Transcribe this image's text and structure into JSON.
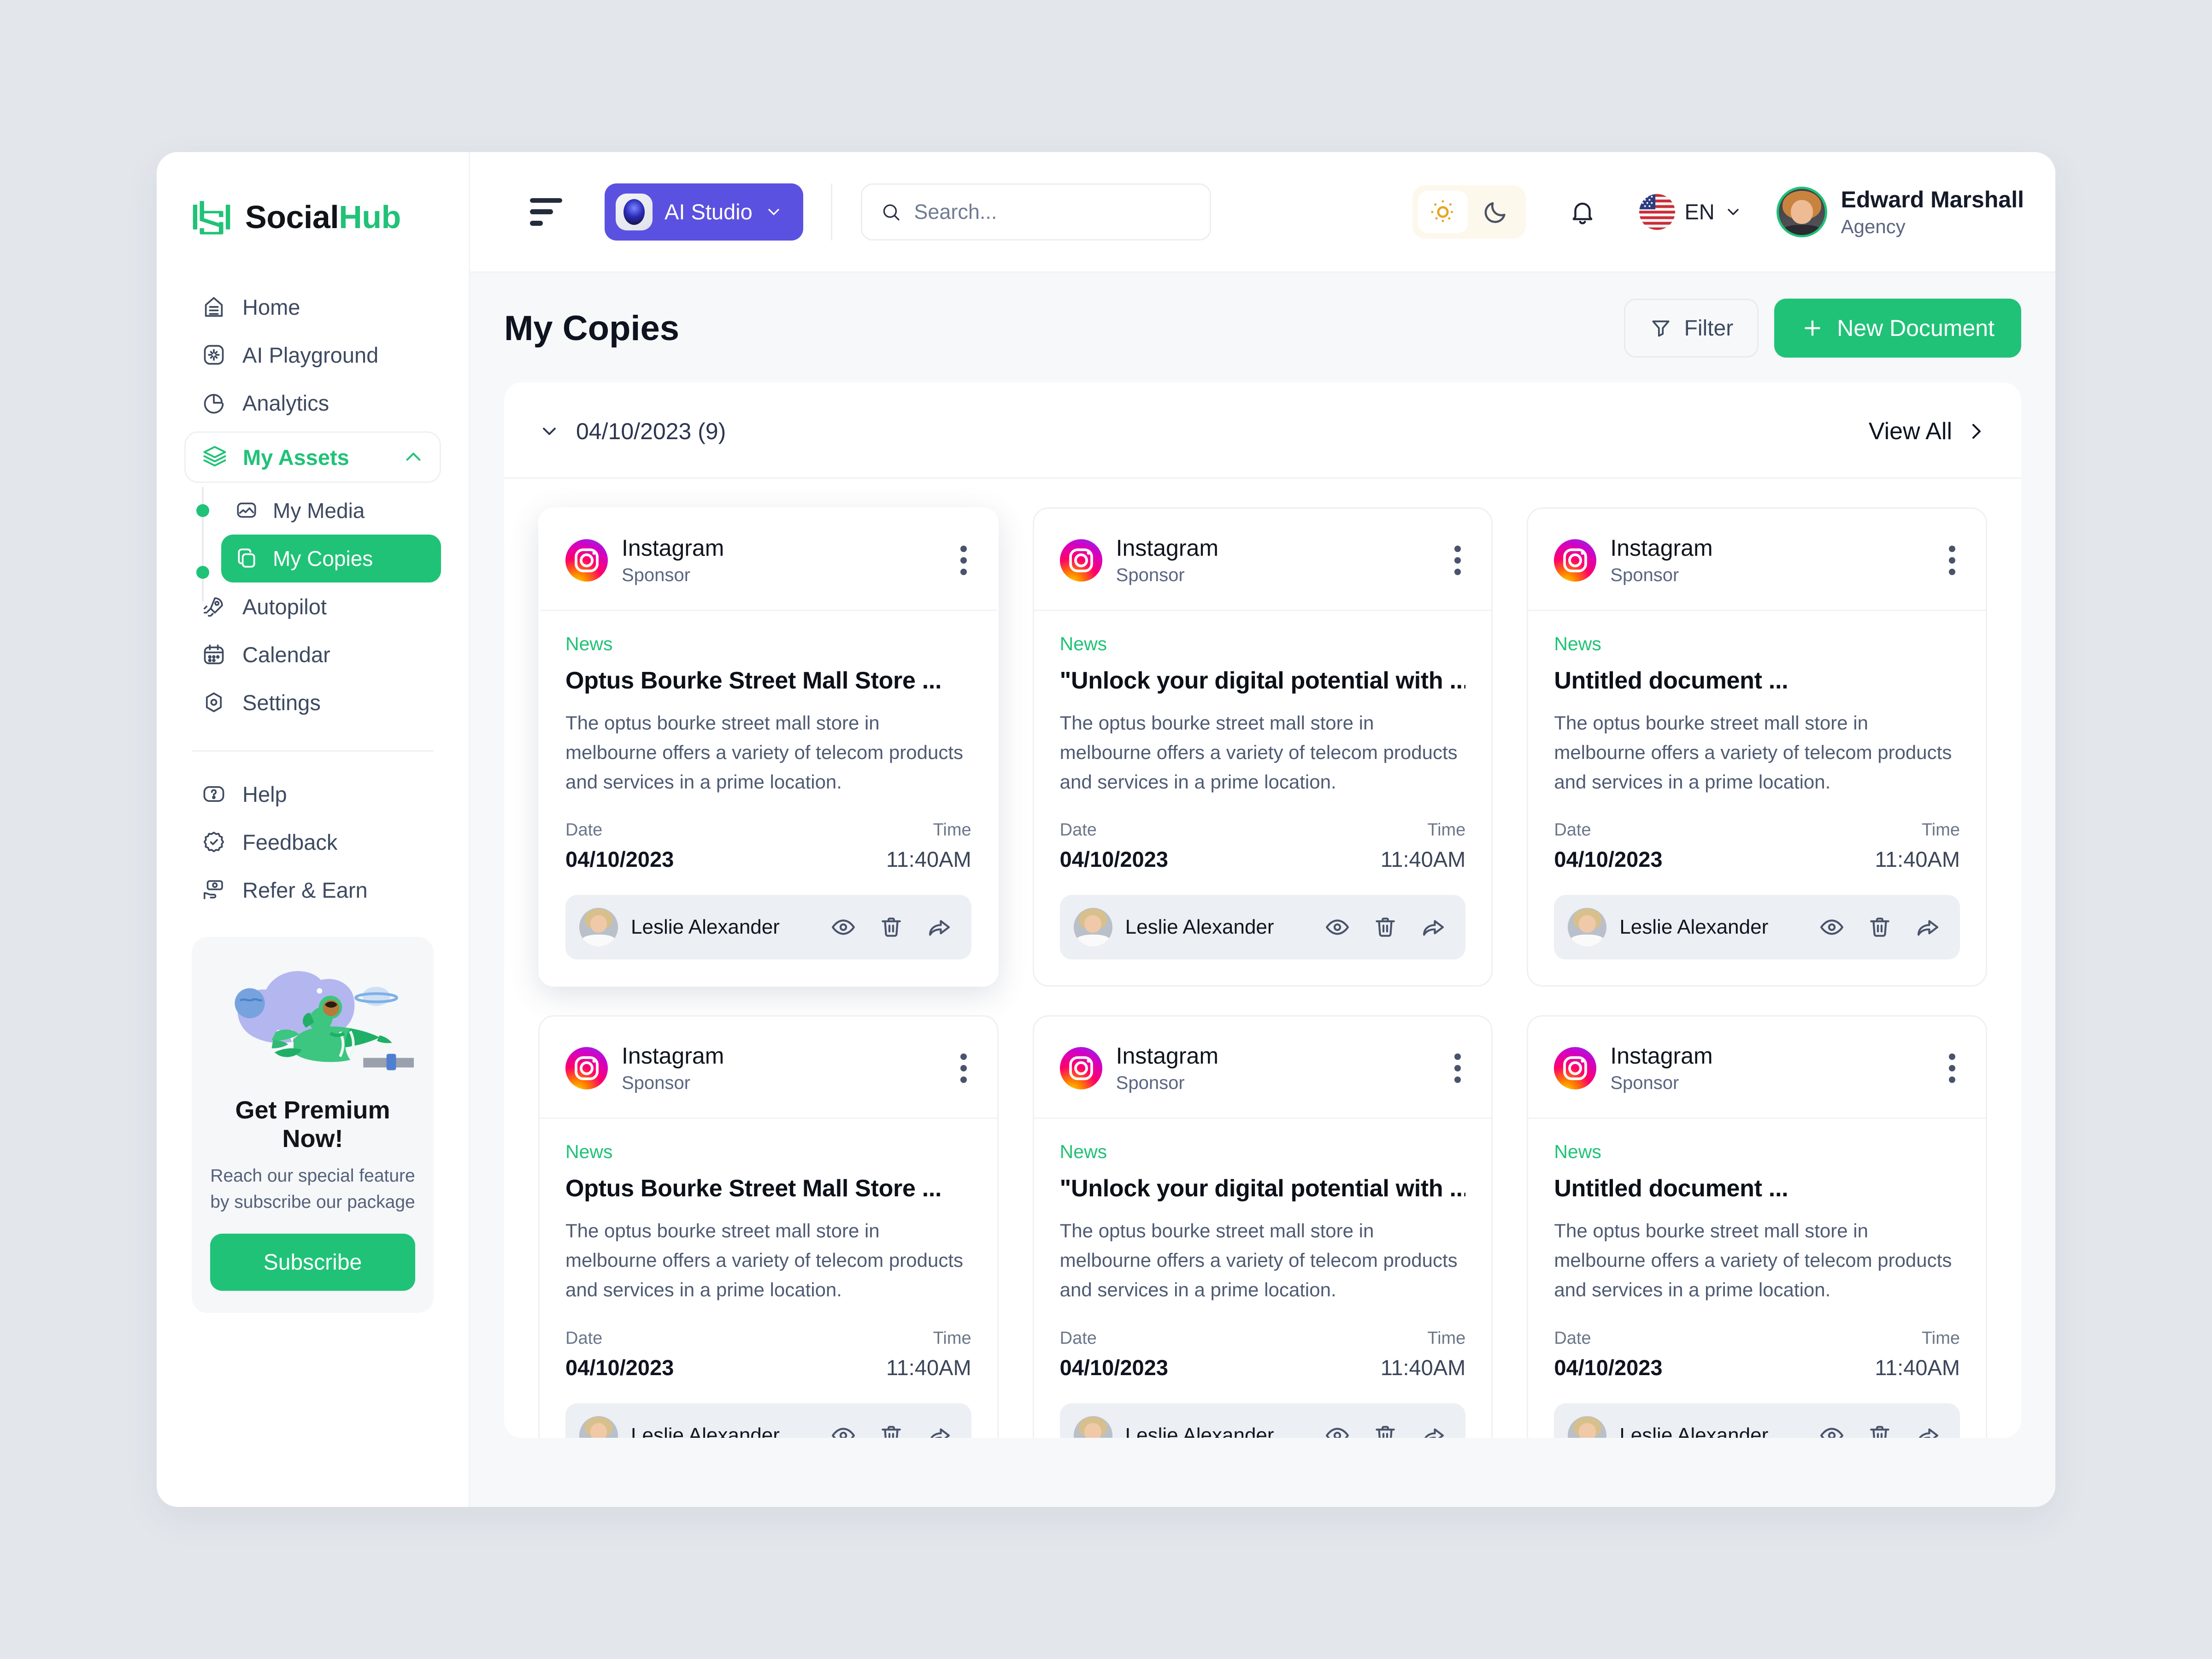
{
  "brand": {
    "name_dark": "Social",
    "name_accent": "Hub",
    "logo_icon": "socialhub-logo-icon"
  },
  "sidebar": {
    "items": [
      {
        "label": "Home",
        "icon": "home-icon"
      },
      {
        "label": "AI Playground",
        "icon": "ai-playground-icon"
      },
      {
        "label": "Analytics",
        "icon": "analytics-pie-icon"
      }
    ],
    "group": {
      "label": "My Assets",
      "icon": "layers-icon",
      "chevron": "chevron-up-icon",
      "expanded": true
    },
    "subitems": [
      {
        "label": "My Media",
        "icon": "media-image-icon",
        "active": false
      },
      {
        "label": "My Copies",
        "icon": "copies-stack-icon",
        "active": true
      }
    ],
    "items_after": [
      {
        "label": "Autopilot",
        "icon": "rocket-icon"
      },
      {
        "label": "Calendar",
        "icon": "calendar-icon"
      },
      {
        "label": "Settings",
        "icon": "settings-gear-icon"
      }
    ],
    "footer_items": [
      {
        "label": "Help",
        "icon": "help-question-icon"
      },
      {
        "label": "Feedback",
        "icon": "feedback-badge-check-icon"
      },
      {
        "label": "Refer & Earn",
        "icon": "refer-earn-money-hand-icon"
      }
    ],
    "premium": {
      "title": "Get Premium Now!",
      "subtitle": "Reach our special feature by subscribe our package",
      "button": "Subscribe",
      "art_icon": "astronaut-rocket-illustration"
    }
  },
  "topbar": {
    "menu_icon": "hamburger-menu-icon",
    "ai_studio": {
      "label": "AI Studio",
      "icon": "ai-orb-icon",
      "chevron": "chevron-down-icon"
    },
    "search": {
      "placeholder": "Search...",
      "value": "",
      "icon": "search-icon"
    },
    "theme": {
      "light_icon": "sun-icon",
      "dark_icon": "moon-icon",
      "active": "light"
    },
    "notifications_icon": "bell-icon",
    "language": {
      "label": "EN",
      "flag": "us-flag-icon",
      "chevron": "chevron-down-icon"
    },
    "profile": {
      "name": "Edward Marshall",
      "role": "Agency",
      "avatar": "user-avatar"
    }
  },
  "page": {
    "title": "My Copies",
    "filter_button": {
      "label": "Filter",
      "icon": "filter-funnel-icon"
    },
    "new_doc_button": {
      "label": "New Document",
      "icon": "plus-icon"
    },
    "group": {
      "date": "04/10/2023 (9)",
      "chevron": "chevron-down-icon"
    },
    "view_all": {
      "label": "View All",
      "icon": "chevron-right-icon"
    }
  },
  "cards": [
    {
      "source": "Instagram",
      "source_sub": "Sponsor",
      "tag": "News",
      "title": "Optus Bourke Street Mall Store ...",
      "desc": "The optus bourke street mall store in melbourne offers a variety of telecom products and services in a prime location.",
      "date_label": "Date",
      "date": "04/10/2023",
      "time_label": "Time",
      "time": "11:40AM",
      "author": "Leslie Alexander",
      "actions": [
        "eye-icon",
        "trash-icon",
        "share-icon"
      ],
      "menu_icon": "kebab-menu-icon",
      "elevated": true
    },
    {
      "source": "Instagram",
      "source_sub": "Sponsor",
      "tag": "News",
      "title": "\"Unlock your digital potential with ...",
      "desc": "The optus bourke street mall store in melbourne offers a variety of telecom products and services in a prime location.",
      "date_label": "Date",
      "date": "04/10/2023",
      "time_label": "Time",
      "time": "11:40AM",
      "author": "Leslie Alexander",
      "actions": [
        "eye-icon",
        "trash-icon",
        "share-icon"
      ],
      "menu_icon": "kebab-menu-icon",
      "elevated": false
    },
    {
      "source": "Instagram",
      "source_sub": "Sponsor",
      "tag": "News",
      "title": "Untitled document ...",
      "desc": "The optus bourke street mall store in melbourne offers a variety of telecom products and services in a prime location.",
      "date_label": "Date",
      "date": "04/10/2023",
      "time_label": "Time",
      "time": "11:40AM",
      "author": "Leslie Alexander",
      "actions": [
        "eye-icon",
        "trash-icon",
        "share-icon"
      ],
      "menu_icon": "kebab-menu-icon",
      "elevated": false
    },
    {
      "source": "Instagram",
      "source_sub": "Sponsor",
      "tag": "News",
      "title": "Optus Bourke Street Mall Store ...",
      "desc": "The optus bourke street mall store in melbourne offers a variety of telecom products and services in a prime location.",
      "date_label": "Date",
      "date": "04/10/2023",
      "time_label": "Time",
      "time": "11:40AM",
      "author": "Leslie Alexander",
      "actions": [
        "eye-icon",
        "trash-icon",
        "share-icon"
      ],
      "menu_icon": "kebab-menu-icon",
      "elevated": false
    },
    {
      "source": "Instagram",
      "source_sub": "Sponsor",
      "tag": "News",
      "title": "\"Unlock your digital potential with ...",
      "desc": "The optus bourke street mall store in melbourne offers a variety of telecom products and services in a prime location.",
      "date_label": "Date",
      "date": "04/10/2023",
      "time_label": "Time",
      "time": "11:40AM",
      "author": "Leslie Alexander",
      "actions": [
        "eye-icon",
        "trash-icon",
        "share-icon"
      ],
      "menu_icon": "kebab-menu-icon",
      "elevated": false
    },
    {
      "source": "Instagram",
      "source_sub": "Sponsor",
      "tag": "News",
      "title": "Untitled document ...",
      "desc": "The optus bourke street mall store in melbourne offers a variety of telecom products and services in a prime location.",
      "date_label": "Date",
      "date": "04/10/2023",
      "time_label": "Time",
      "time": "11:40AM",
      "author": "Leslie Alexander",
      "actions": [
        "eye-icon",
        "trash-icon",
        "share-icon"
      ],
      "menu_icon": "kebab-menu-icon",
      "elevated": false
    }
  ],
  "colors": {
    "brand_green": "#20c277",
    "ai_studio_purple": "#5b51e0",
    "page_bg": "#e3e7ec",
    "content_bg": "#f7f8f9",
    "text_dark": "#0e1320",
    "text_muted": "#5a6681",
    "sun_amber": "#e8a321"
  }
}
